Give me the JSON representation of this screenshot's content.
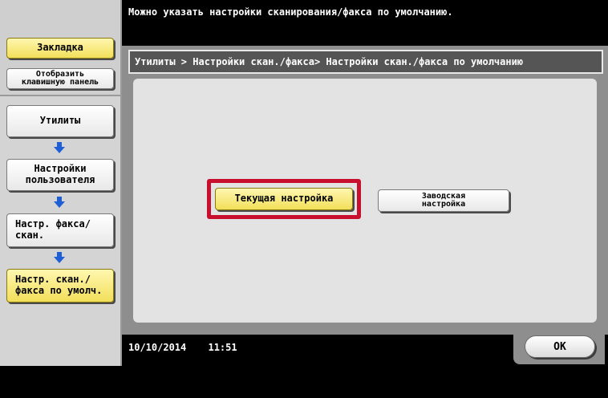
{
  "top_message": "Можно указать настройки сканирования/факса по умолчанию.",
  "sidebar": {
    "bookmark_label": "Закладка",
    "keyboard_label_1": "Отобразить",
    "keyboard_label_2": "клавишную панель",
    "nav": [
      {
        "label_1": "Утилиты",
        "label_2": ""
      },
      {
        "label_1": "Настройки",
        "label_2": "пользователя"
      },
      {
        "label_1": "Настр. факса/",
        "label_2": "скан."
      },
      {
        "label_1": "Настр. скан./",
        "label_2": "факса по умолч."
      }
    ],
    "arrow_color": "#1e5fd8"
  },
  "breadcrumb": "Утилиты > Настройки скан./факса> Настройки скан./факса по умолчанию",
  "options": {
    "current_label": "Текущая настройка",
    "factory_label_1": "Заводская",
    "factory_label_2": "настройка",
    "selected": "current"
  },
  "status": {
    "date": "10/10/2014",
    "time": "11:51"
  },
  "ok_label": "ОК",
  "colors": {
    "highlight": "#c8102e",
    "selected_button": "#f2df5a"
  }
}
